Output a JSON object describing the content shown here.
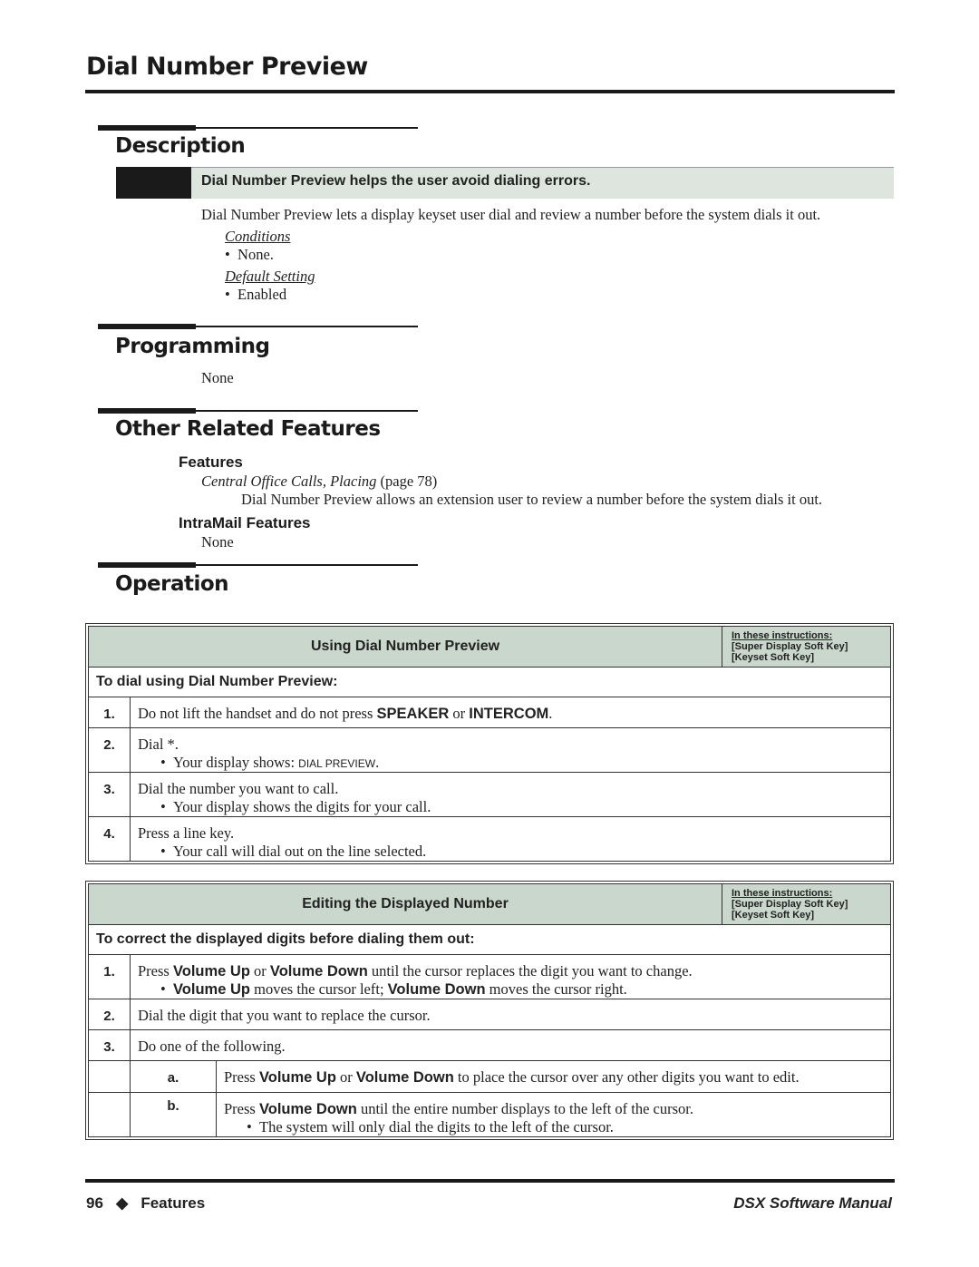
{
  "page_title": "Dial Number Preview",
  "description": {
    "heading": "Description",
    "summary": "Dial Number Preview helps the user avoid dialing errors.",
    "text": "Dial Number Preview lets a display keyset user dial and review a number before the system dials it out.",
    "conditions_label": "Conditions",
    "conditions": [
      "None."
    ],
    "default_label": "Default Setting",
    "default": [
      "Enabled"
    ]
  },
  "programming": {
    "heading": "Programming",
    "text": "None"
  },
  "related": {
    "heading": "Other Related Features",
    "features_label": "Features",
    "feature_link": "Central Office Calls, Placing",
    "feature_page": "(page 78)",
    "feature_desc": "Dial Number Preview allows an extension user to review a number before the system dials it out.",
    "intramail_label": "IntraMail Features",
    "intramail": "None"
  },
  "operation": {
    "heading": "Operation",
    "key_legend": [
      "In these instructions:",
      "[Super Display Soft Key]",
      "[Keyset Soft Key]"
    ],
    "table1": {
      "title": "Using Dial Number Preview",
      "intro": "To dial using Dial Number Preview:",
      "steps": [
        {
          "n": "1.",
          "pre": "Do not lift the handset and do not press ",
          "k1": "SPEAKER",
          "mid": " or ",
          "k2": "INTERCOM",
          "post": "."
        },
        {
          "n": "2.",
          "text": "Dial *.",
          "bullet_pre": "Your display shows: ",
          "bullet_code": "DIAL PREVIEW",
          "bullet_post": "."
        },
        {
          "n": "3.",
          "text": "Dial the number you want to call.",
          "bullet": "Your display shows the digits for your call."
        },
        {
          "n": "4.",
          "text": "Press a line key.",
          "bullet": "Your call will dial out on the line selected."
        }
      ]
    },
    "table2": {
      "title": "Editing the Displayed Number",
      "intro": "To correct the displayed digits before dialing them out:",
      "steps": [
        {
          "n": "1.",
          "t1": "Press ",
          "k1": "Volume Up",
          "t2": " or ",
          "k2": "Volume Down",
          "t3": " until the cursor replaces the digit you want to change.",
          "b_k1": "Volume Up",
          "b_t1": " moves the cursor left; ",
          "b_k2": "Volume Down",
          "b_t2": " moves the cursor right."
        },
        {
          "n": "2.",
          "text": "Dial the digit that you want to replace the cursor."
        },
        {
          "n": "3.",
          "text": "Do one of the following."
        }
      ],
      "substeps": [
        {
          "n": "a.",
          "t1": "Press ",
          "k1": "Volume Up",
          "t2": " or ",
          "k2": "Volume Down",
          "t3": " to place the cursor over any other digits you want to edit."
        },
        {
          "n": "b.",
          "t1": "Press ",
          "k1": "Volume Down",
          "t2": " until the entire number displays to the left of the cursor.",
          "bullet": "The system will only dial the digits to the left of the cursor."
        }
      ]
    }
  },
  "footer": {
    "page": "96",
    "diamond": "◆",
    "section": "Features",
    "manual": "DSX Software Manual"
  },
  "colors": {
    "header_fill": "#c9d7cc",
    "summary_fill": "#dde5de",
    "rule": "#1a1a1a"
  }
}
